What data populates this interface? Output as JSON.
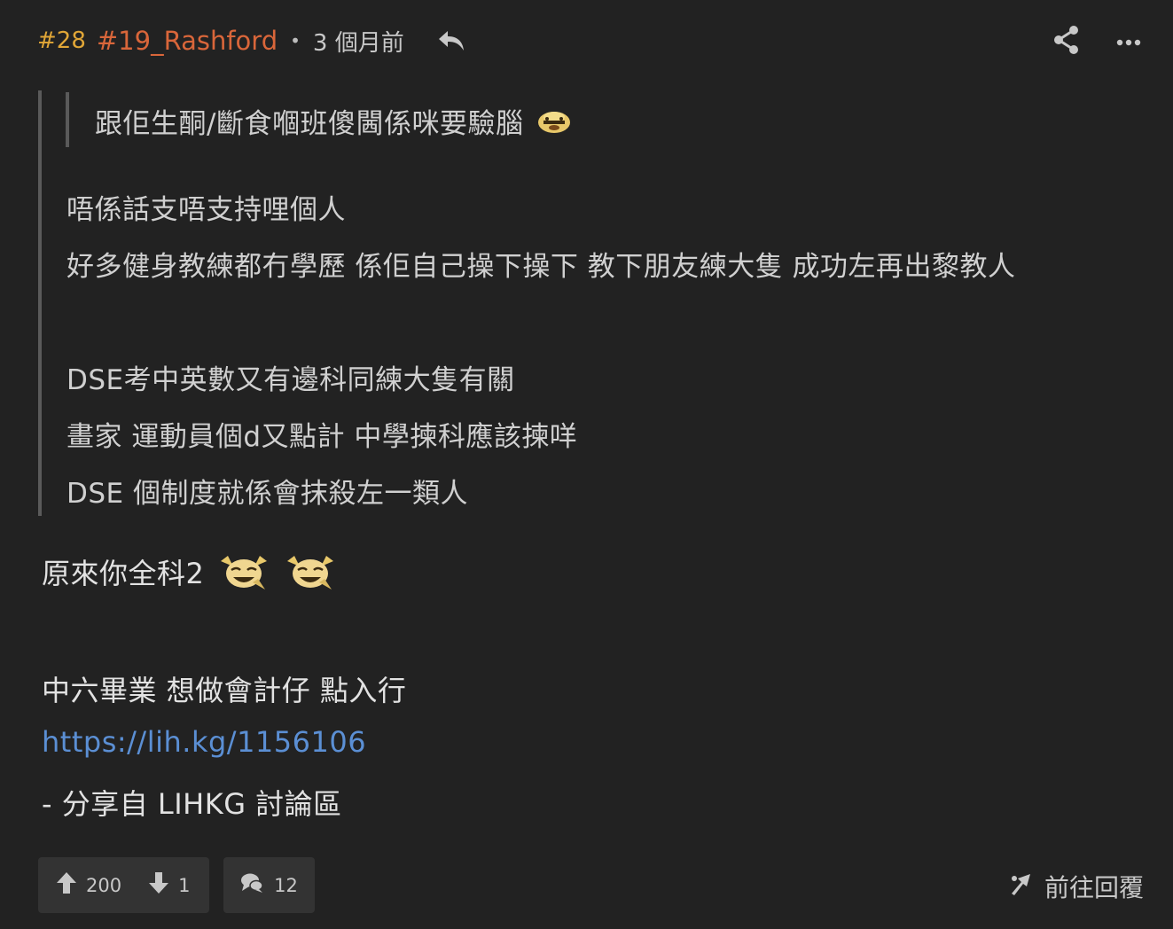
{
  "header": {
    "floor": "#28",
    "username": "#19_Rashford",
    "separator": "•",
    "time": "3 個月前"
  },
  "quote_nested": {
    "text": "跟佢生酮/斷食嗰班傻閪係咪要驗腦"
  },
  "quote": {
    "lines": [
      "唔係話支唔支持哩個人",
      "好多健身教練都冇學歷 係佢自己操下操下 教下朋友練大隻 成功左再出黎教人",
      "DSE考中英數又有邊科同練大隻有關",
      "畫家 運動員個d又點計 中學揀科應該揀咩",
      "DSE 個制度就係會抹殺左一類人"
    ]
  },
  "body": {
    "line1": "原來你全科2",
    "line2": "中六畢業 想做會計仔 點入行",
    "link": "https://lih.kg/1156106",
    "line4": "- 分享自 LIHKG 討論區"
  },
  "footer": {
    "upvotes": "200",
    "downvotes": "1",
    "comments": "12",
    "goto_reply": "前往回覆"
  },
  "colors": {
    "floor": "#e0a637",
    "username": "#d9663a",
    "link": "#5b8fd4",
    "background": "#222222"
  },
  "icons": {
    "reply": "reply-arrow-icon",
    "share": "share-icon",
    "more": "more-dots-icon",
    "upvote": "arrow-up-icon",
    "downvote": "arrow-down-icon",
    "comment": "speech-bubble-icon",
    "goto": "reply-jump-icon"
  }
}
